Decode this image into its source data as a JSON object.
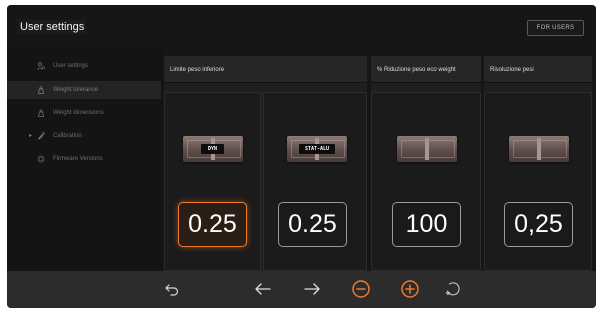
{
  "header": {
    "title": "User settings",
    "users_button": "FOR USERS"
  },
  "sidebar": {
    "items": [
      {
        "label": "User settings",
        "icon": "user-settings-icon",
        "active": false
      },
      {
        "label": "Weight tolerance",
        "icon": "weight-icon",
        "active": true
      },
      {
        "label": "Weight dimensions",
        "icon": "weight-dimensions-icon",
        "active": false
      },
      {
        "label": "Calibration",
        "icon": "calibration-icon",
        "active": false
      },
      {
        "label": "Firmware Versions",
        "icon": "firmware-icon",
        "active": false
      }
    ]
  },
  "columns": [
    {
      "header": "Limite peso inferiore",
      "tiles": [
        {
          "badge": "DYN",
          "value": "0.25",
          "active": true
        },
        {
          "badge": "STAT-ALU",
          "value": "0.25",
          "active": false
        }
      ]
    },
    {
      "header": "% Riduzione peso eco weight",
      "tiles": [
        {
          "badge": "",
          "value": "100",
          "active": false
        }
      ]
    },
    {
      "header": "Risoluzione pesi",
      "tiles": [
        {
          "badge": "",
          "value": "0,25",
          "active": false
        }
      ]
    }
  ],
  "toolbar": {
    "icons": [
      "back-icon",
      "arrow-left-icon",
      "arrow-right-icon",
      "minus-circle-icon",
      "plus-circle-icon",
      "reset-icon"
    ]
  },
  "colors": {
    "accent": "#ee7a2c",
    "background": "#111111",
    "panel": "#1f1f1f"
  }
}
